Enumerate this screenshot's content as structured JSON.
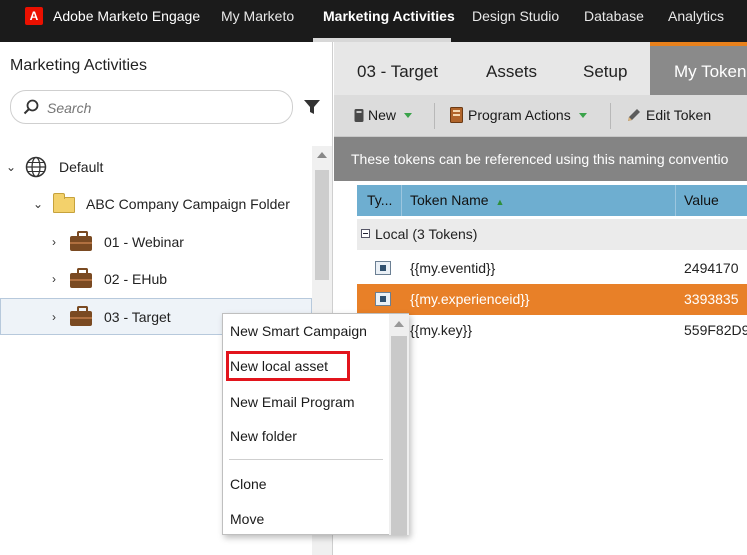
{
  "topnav": {
    "brand": "Adobe Marketo Engage",
    "logo_letter": "A",
    "items": [
      "My Marketo",
      "Marketing Activities",
      "Design Studio",
      "Database",
      "Analytics"
    ],
    "active": "Marketing Activities"
  },
  "left_panel": {
    "title": "Marketing Activities",
    "search_placeholder": "Search",
    "tree": [
      {
        "label": "Default",
        "type": "workspace",
        "expanded": true
      },
      {
        "label": "ABC Company Campaign Folder",
        "type": "folder",
        "expanded": true
      },
      {
        "label": "01 - Webinar",
        "type": "program",
        "expanded": false
      },
      {
        "label": "02 - EHub",
        "type": "program",
        "expanded": false
      },
      {
        "label": "03 - Target",
        "type": "program",
        "expanded": false,
        "selected": true
      }
    ]
  },
  "context_menu": {
    "items": [
      "New Smart Campaign",
      "New local asset",
      "New Email Program",
      "New folder",
      "Clone",
      "Move"
    ],
    "highlighted": "New local asset"
  },
  "right_panel": {
    "tabs": [
      "03 - Target",
      "Assets",
      "Setup",
      "My Token"
    ],
    "active_tab": "My Token",
    "toolbar": {
      "new_label": "New",
      "program_actions_label": "Program Actions",
      "edit_token_label": "Edit Token"
    },
    "info_text": "These tokens can be referenced using this naming conventio",
    "grid": {
      "columns": [
        "Ty...",
        "Token Name",
        "Value"
      ],
      "group_label": "Local (3 Tokens)",
      "rows": [
        {
          "token": "{{my.eventid}}",
          "value": "2494170",
          "selected": false
        },
        {
          "token": "{{my.experienceid}}",
          "value": "3393835",
          "selected": true
        },
        {
          "token": "{{my.key}}",
          "value": "559F82D9",
          "selected": false
        }
      ]
    }
  },
  "colors": {
    "topnav_bg": "#1b1b1b",
    "accent_orange": "#e88028",
    "grid_header_blue": "#6eaed0",
    "highlight_red": "#e2141c"
  }
}
